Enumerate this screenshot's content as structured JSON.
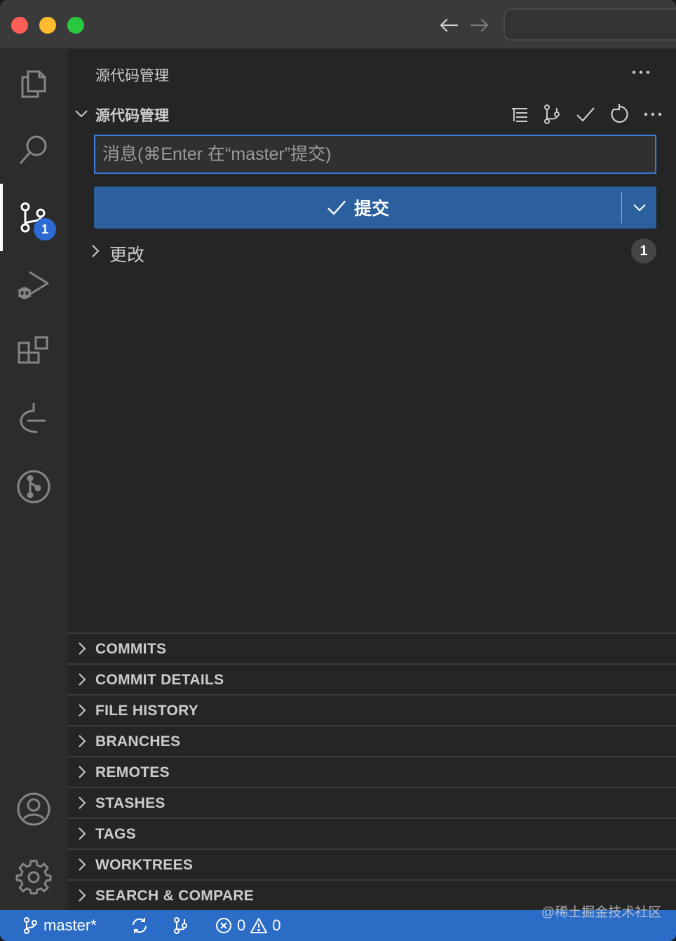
{
  "sidebar": {
    "title": "源代码管理",
    "section_title": "源代码管理",
    "commit_placeholder": "消息(⌘Enter 在“master”提交)",
    "commit_button_label": "提交",
    "changes_label": "更改",
    "changes_count": "1"
  },
  "activity_bar": {
    "scm_badge": "1",
    "items": [
      "explorer-icon",
      "search-icon",
      "source-control-icon",
      "run-debug-icon",
      "extensions-icon",
      "timeline-icon",
      "gitlens-icon",
      "account-icon",
      "settings-gear-icon"
    ]
  },
  "panes": [
    {
      "title": "COMMITS"
    },
    {
      "title": "COMMIT DETAILS"
    },
    {
      "title": "FILE HISTORY"
    },
    {
      "title": "BRANCHES"
    },
    {
      "title": "REMOTES"
    },
    {
      "title": "STASHES"
    },
    {
      "title": "TAGS"
    },
    {
      "title": "WORKTREES"
    },
    {
      "title": "SEARCH & COMPARE"
    }
  ],
  "statusbar": {
    "branch": "master*",
    "errors": "0",
    "warnings": "0"
  },
  "watermark": "@稀土掘金技术社区",
  "colors": {
    "accent": "#2b6cc6",
    "commit_button": "#2c5f9e",
    "badge": "#2d6ad1"
  }
}
